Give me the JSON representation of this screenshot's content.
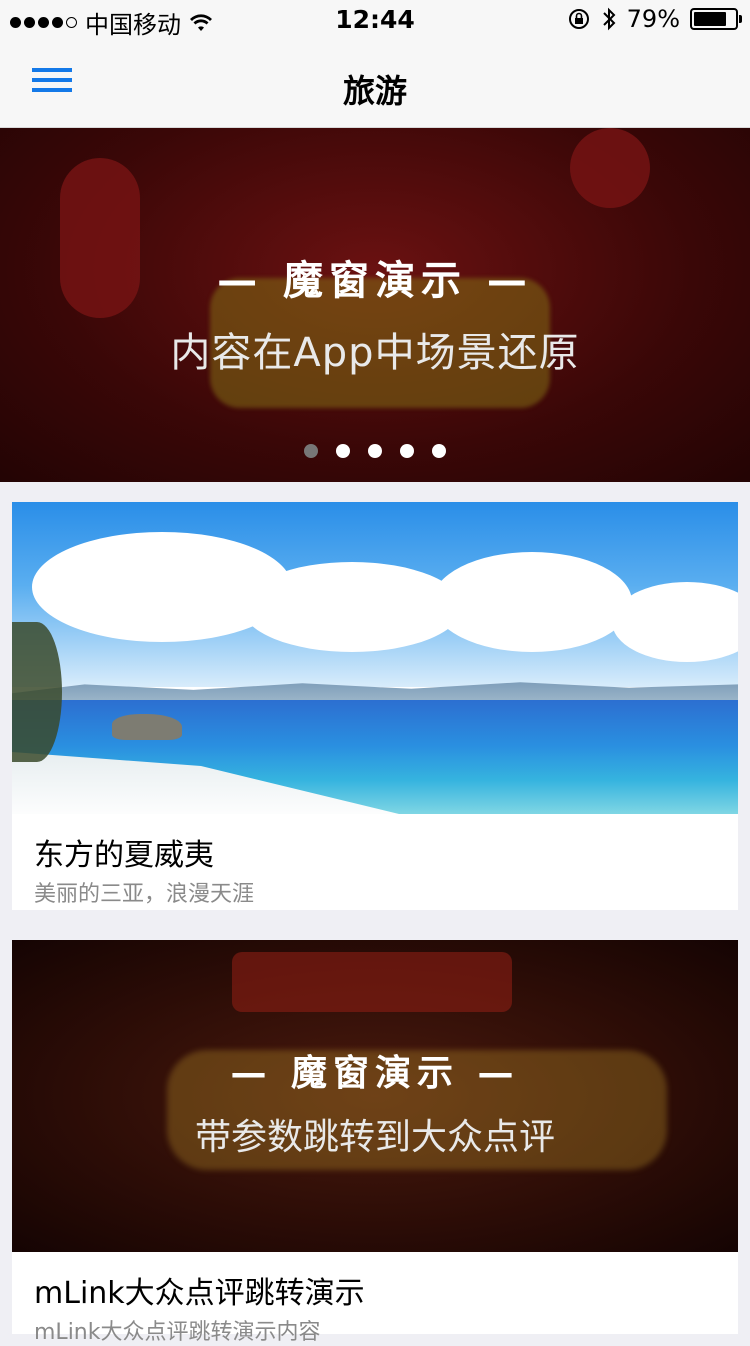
{
  "status": {
    "carrier": "中国移动",
    "time": "12:44",
    "battery": "79%",
    "battery_level": 0.79
  },
  "nav": {
    "title": "旅游"
  },
  "banner": {
    "title": "— 魔窗演示 —",
    "subtitle": "内容在App中场景还原",
    "page_count": 5,
    "active_index": 0
  },
  "cards": [
    {
      "title": "东方的夏威夷",
      "subtitle": "美丽的三亚，浪漫天涯"
    },
    {
      "overlay_title": "— 魔窗演示 —",
      "overlay_subtitle": "带参数跳转到大众点评",
      "title": "mLink大众点评跳转演示",
      "subtitle": "mLink大众点评跳转演示内容"
    }
  ],
  "icons": {
    "menu": "menu-icon",
    "wifi": "wifi-icon",
    "lock": "orientation-lock-icon",
    "bluetooth": "bluetooth-icon",
    "battery": "battery-icon"
  },
  "colors": {
    "accent": "#1479e8"
  }
}
